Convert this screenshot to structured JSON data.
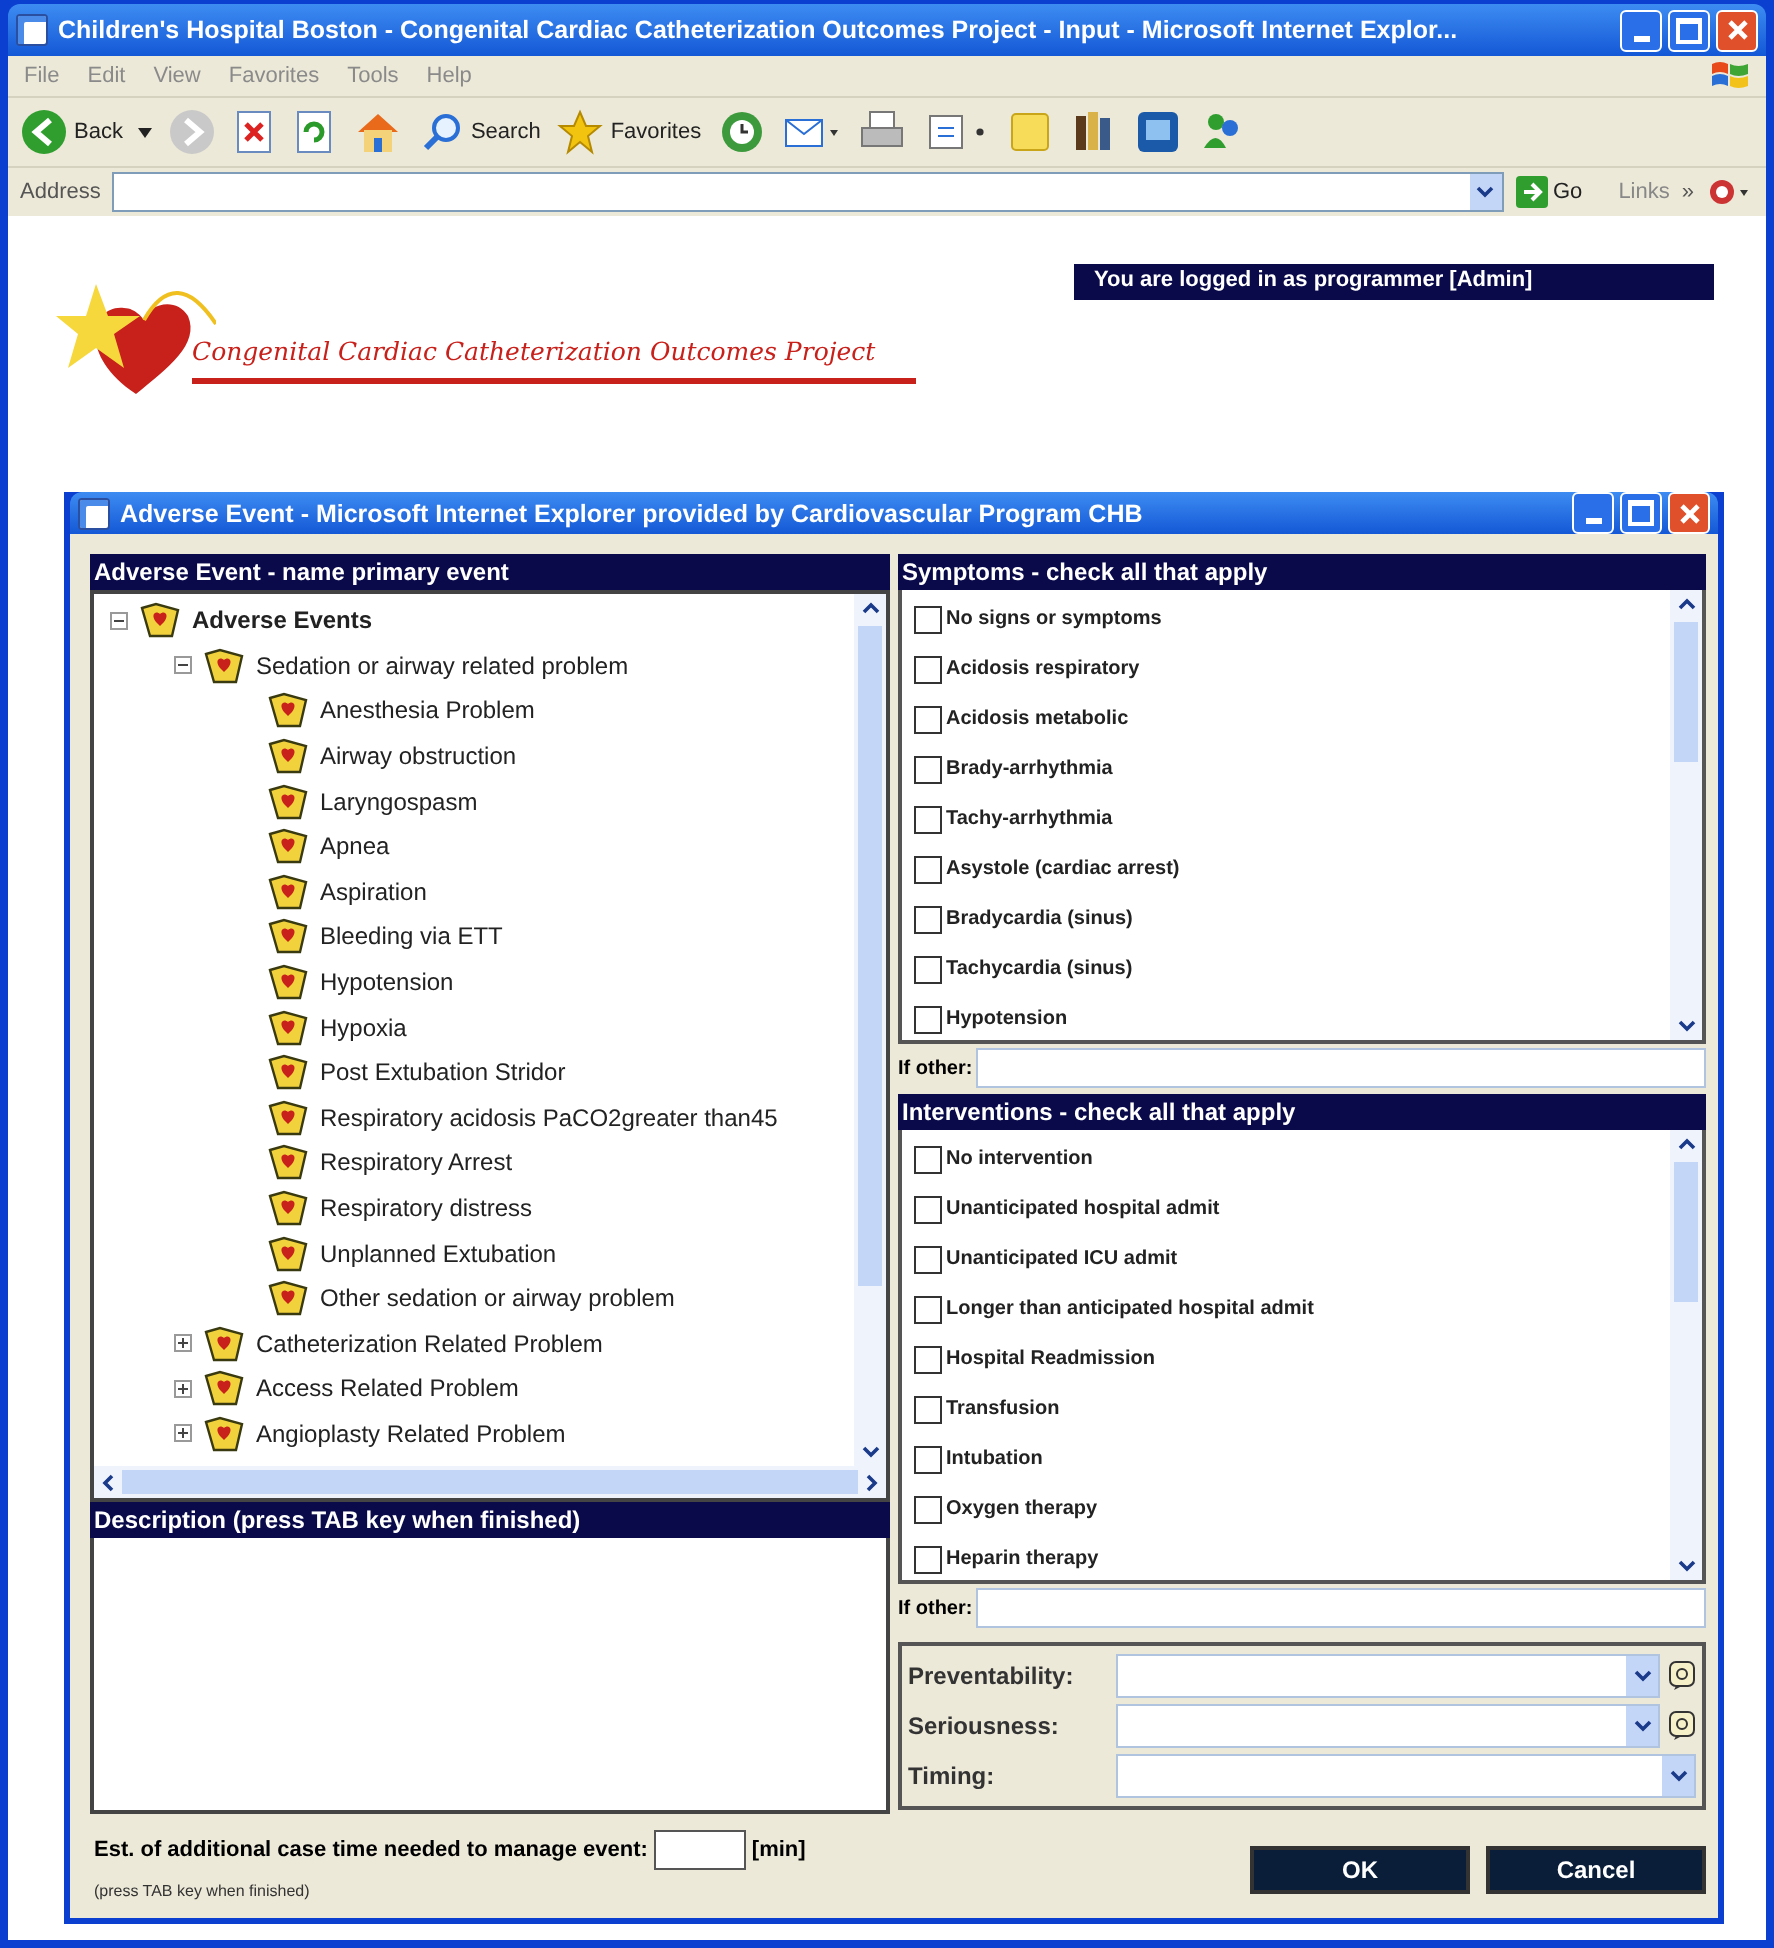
{
  "window": {
    "title": "Children's Hospital Boston - Congenital Cardiac Catheterization Outcomes Project - Input - Microsoft Internet Explor..."
  },
  "menu": [
    "File",
    "Edit",
    "View",
    "Favorites",
    "Tools",
    "Help"
  ],
  "toolbar": {
    "back": "Back",
    "search": "Search",
    "favorites": "Favorites"
  },
  "address_bar": {
    "label": "Address",
    "go": "Go",
    "links": "Links",
    "links_more": "»"
  },
  "page": {
    "logged_in": "You are logged in as programmer [Admin]",
    "logo_text": "Congenital Cardiac Catheterization Outcomes Project"
  },
  "dialog": {
    "title": "Adverse Event - Microsoft Internet Explorer provided by Cardiovascular Program CHB",
    "tree": {
      "heading": "Adverse Event - name primary event",
      "nodes": [
        {
          "label": "Adverse Events",
          "expanded": true,
          "bold": true,
          "children": [
            {
              "label": "Sedation or airway related problem",
              "expanded": true,
              "children": [
                {
                  "label": "Anesthesia Problem"
                },
                {
                  "label": "Airway obstruction"
                },
                {
                  "label": "Laryngospasm"
                },
                {
                  "label": "Apnea"
                },
                {
                  "label": "Aspiration"
                },
                {
                  "label": "Bleeding via ETT"
                },
                {
                  "label": "Hypotension"
                },
                {
                  "label": "Hypoxia"
                },
                {
                  "label": "Post Extubation Stridor"
                },
                {
                  "label": "Respiratory acidosis PaCO2greater than45"
                },
                {
                  "label": "Respiratory Arrest"
                },
                {
                  "label": "Respiratory distress"
                },
                {
                  "label": "Unplanned Extubation"
                },
                {
                  "label": "Other sedation or airway problem"
                }
              ]
            },
            {
              "label": "Catheterization Related Problem",
              "expanded": false
            },
            {
              "label": "Access Related Problem",
              "expanded": false
            },
            {
              "label": "Angioplasty Related Problem",
              "expanded": false
            }
          ]
        }
      ]
    },
    "description": {
      "heading": "Description (press TAB key when finished)"
    },
    "estimate": {
      "label": "Est. of additional case time needed to manage event:",
      "unit": "[min]",
      "note": "(press TAB key when finished)"
    },
    "symptoms": {
      "heading": "Symptoms - check all that apply",
      "items": [
        {
          "label": "No signs or symptoms",
          "checked": false
        },
        {
          "label": "Acidosis respiratory",
          "checked": false
        },
        {
          "label": "Acidosis metabolic",
          "checked": false
        },
        {
          "label": "Brady-arrhythmia",
          "checked": false
        },
        {
          "label": "Tachy-arrhythmia",
          "checked": false
        },
        {
          "label": "Asystole (cardiac arrest)",
          "checked": false
        },
        {
          "label": "Bradycardia (sinus)",
          "checked": false
        },
        {
          "label": "Tachycardia (sinus)",
          "checked": false
        },
        {
          "label": "Hypotension",
          "checked": false
        }
      ],
      "other_label": "If other:"
    },
    "interventions": {
      "heading": "Interventions - check all that apply",
      "items": [
        {
          "label": "No intervention",
          "checked": false
        },
        {
          "label": "Unanticipated hospital admit",
          "checked": false
        },
        {
          "label": "Unanticipated ICU admit",
          "checked": false
        },
        {
          "label": "Longer than anticipated hospital admit",
          "checked": false
        },
        {
          "label": "Hospital Readmission",
          "checked": false
        },
        {
          "label": "Transfusion",
          "checked": false
        },
        {
          "label": "Intubation",
          "checked": false
        },
        {
          "label": "Oxygen therapy",
          "checked": false
        },
        {
          "label": "Heparin therapy",
          "checked": false
        }
      ],
      "other_label": "If other:"
    },
    "selects": [
      {
        "label": "Preventability:",
        "help": true
      },
      {
        "label": "Seriousness:",
        "help": true
      },
      {
        "label": "Timing:",
        "help": false
      }
    ],
    "buttons": [
      "OK",
      "Cancel"
    ]
  }
}
